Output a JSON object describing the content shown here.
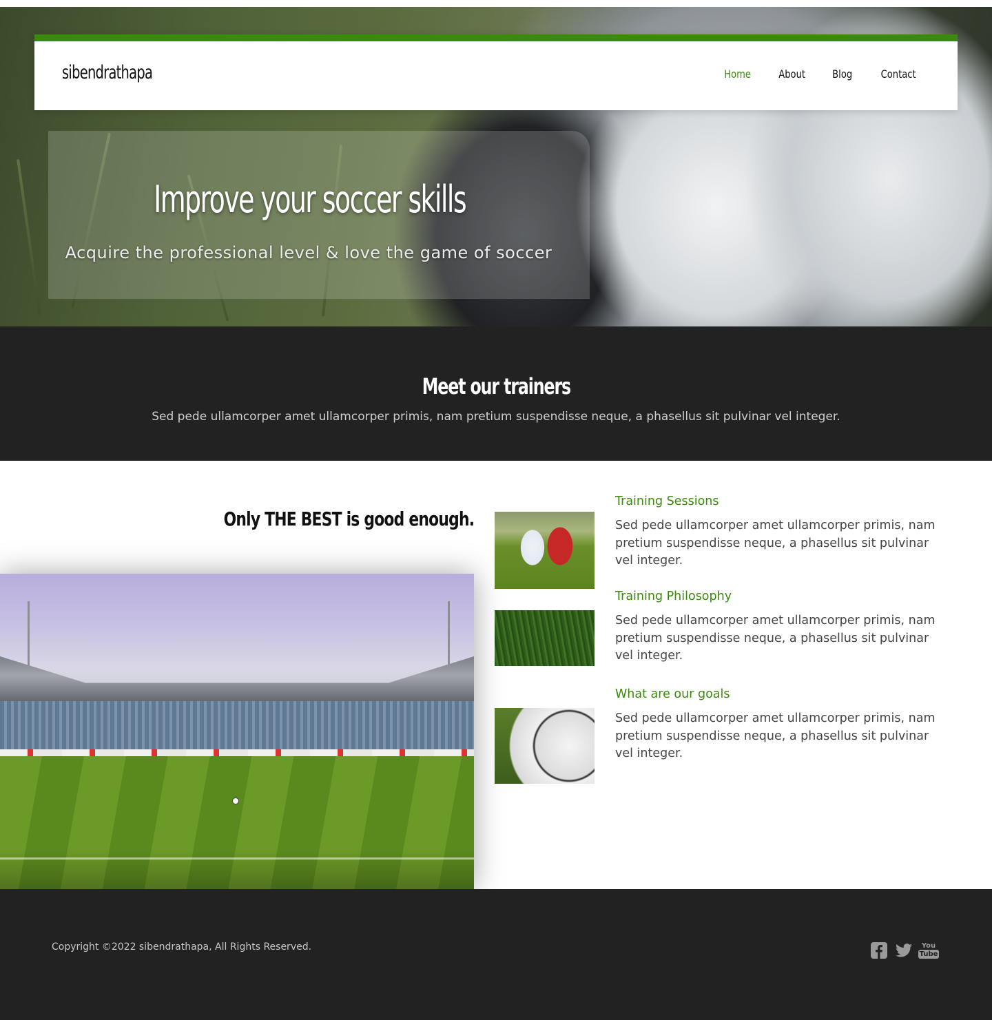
{
  "nav": {
    "brand": "sibendrathapa",
    "links": [
      "Home",
      "About",
      "Blog",
      "Contact"
    ],
    "active_link": "Home"
  },
  "hero": {
    "title": "Improve your soccer skills",
    "subtitle": "Acquire the professional level & love the game of soccer"
  },
  "trainers": {
    "title": "Meet our trainers",
    "text": "Sed pede ullamcorper amet ullamcorper primis, nam pretium suspendisse neque, a phasellus sit pulvinar vel integer."
  },
  "features": {
    "heading": "Only THE BEST is good enough.",
    "items": [
      {
        "title": "Training Sessions",
        "text": "Sed pede ullamcorper amet ullamcorper primis, nam pretium suspendisse neque, a phasellus sit pulvinar vel integer."
      },
      {
        "title": "Training Philosophy",
        "text": "Sed pede ullamcorper amet ullamcorper primis, nam pretium suspendisse neque, a phasellus sit pulvinar vel integer."
      },
      {
        "title": "What are our goals",
        "text": "Sed pede ullamcorper amet ullamcorper primis, nam pretium suspendisse neque, a phasellus sit pulvinar vel integer."
      }
    ]
  },
  "footer": {
    "copyright": "Copyright ©2022 sibendrathapa, All Rights Reserved.",
    "social_icons": [
      "facebook-icon",
      "twitter-icon",
      "youtube-icon"
    ],
    "youtube_text": [
      "You",
      "Tube"
    ]
  },
  "colors": {
    "accent": "#3a8a0b",
    "dark_band": "#222222",
    "social_icon": "#9a9a9a"
  }
}
